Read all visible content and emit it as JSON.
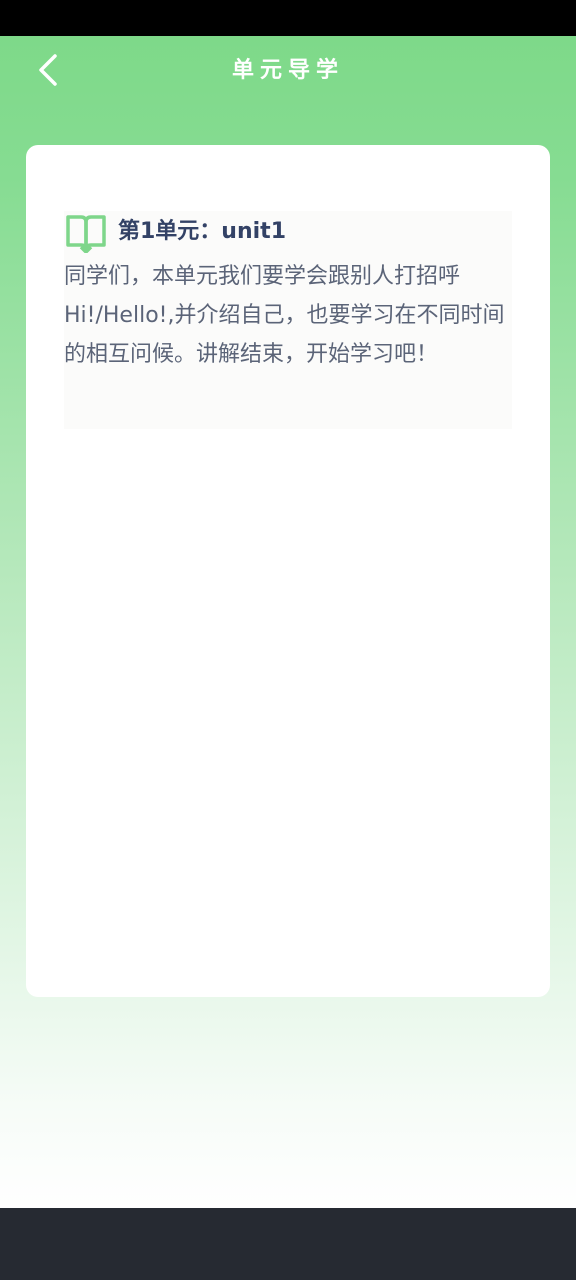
{
  "header": {
    "title": "单元导学",
    "back_icon": "chevron-left-icon"
  },
  "unit": {
    "icon": "open-book-icon",
    "accent_color": "#7ed68a",
    "title": "第1单元：unit1",
    "description": "同学们，本单元我们要学会跟别人打招呼Hi!/Hello!,并介绍自己，也要学习在不同时间的相互问候。讲解结束，开始学习吧！"
  },
  "colors": {
    "header_green": "#7ed989",
    "title_text": "#334266",
    "body_text": "#5b6478"
  }
}
